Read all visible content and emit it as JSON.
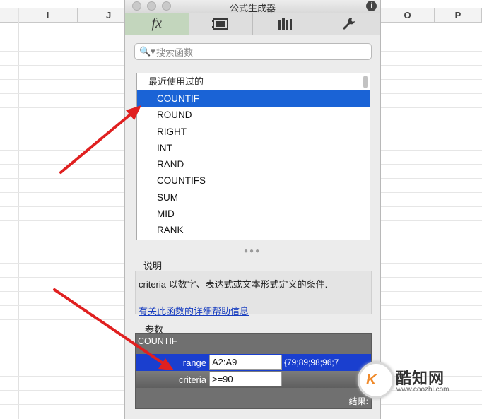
{
  "window_title": "公式生成器",
  "sheet": {
    "columns": [
      "I",
      "J",
      "O",
      "P"
    ]
  },
  "toolbar": {
    "tabs": [
      "fx",
      "gallery",
      "library",
      "settings"
    ]
  },
  "search": {
    "placeholder": "搜索函数"
  },
  "function_list": {
    "header": "最近使用过的",
    "items": [
      "COUNTIF",
      "ROUND",
      "RIGHT",
      "INT",
      "RAND",
      "COUNTIFS",
      "SUM",
      "MID",
      "RANK"
    ],
    "selected": "COUNTIF"
  },
  "description": {
    "label": "说明",
    "text": "criteria 以数字、表达式或文本形式定义的条件.",
    "help_link": "有关此函数的详细帮助信息"
  },
  "params": {
    "label": "参数",
    "function": "COUNTIF",
    "rows": [
      {
        "name": "range",
        "value": "A2:A9",
        "evaluated": "{79;89;98;96;7"
      },
      {
        "name": "criteria",
        "value": ">=90",
        "evaluated": ""
      }
    ],
    "result_label": "结果:"
  },
  "watermark": {
    "logo_text": "K",
    "name": "酷知网",
    "url": "www.coozhi.com"
  },
  "colors": {
    "selection": "#1a63d6",
    "param_selected": "#1a3fcf",
    "arrow": "#e02020",
    "active_tab": "#c3d6bd"
  }
}
